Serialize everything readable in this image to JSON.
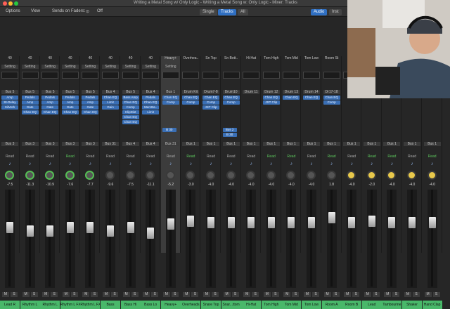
{
  "window": {
    "title": "Writing a Metal Song w/ Only Logic - Writing a Metal Song w: Only Logic - Mixer: Tracks"
  },
  "toolbar": {
    "options": "Options",
    "view": "View",
    "sends_on_faders": "Sends on Faders:",
    "sends_value": "Off",
    "single": "Single",
    "tracks": "Tracks",
    "all": "All",
    "audio": "Audio",
    "inst": "Inst"
  },
  "strips": [
    {
      "name": "Lead R",
      "color": "#49b86a",
      "gain": "40",
      "setting": "Setting",
      "input": "Bus 5",
      "plugins": [
        "Amp",
        "St-Delay",
        "SilVerb"
      ],
      "bus": "Bus 3",
      "read": "Read",
      "read_green": false,
      "vol": "-7.5",
      "pan": "-64",
      "fader": 0.62
    },
    {
      "name": "Rhythm L",
      "color": "#49b86a",
      "gain": "40",
      "setting": "Setting",
      "input": "Bus 5",
      "plugins": [
        "Pedals",
        "Amp",
        "Gate",
        "Chan EQ"
      ],
      "bus": "Bus 3",
      "read": "Read",
      "read_green": false,
      "vol": "-11.3",
      "pan": "-64",
      "fader": 0.58
    },
    {
      "name": "Rhythm L",
      "color": "#49b86a",
      "gain": "40",
      "setting": "Setting",
      "input": "Bus 5",
      "plugins": [
        "Pedals",
        "Amp",
        "Gate",
        "Chan EQ"
      ],
      "bus": "Bus 3",
      "read": "Read",
      "read_green": false,
      "vol": "-10.9",
      "pan": "+63",
      "fader": 0.58
    },
    {
      "name": "Rhythm L FX",
      "color": "#49b86a",
      "gain": "40",
      "setting": "Setting",
      "input": "Bus 5",
      "plugins": [
        "Pedals",
        "Amp",
        "Gate",
        "Chan EQ"
      ],
      "bus": "Bus 3",
      "read": "Read",
      "read_green": true,
      "vol": "-7.6",
      "pan": "-64",
      "fader": 0.62
    },
    {
      "name": "Rhythm L FX",
      "color": "#49b86a",
      "gain": "40",
      "setting": "Setting",
      "input": "Bus 5",
      "plugins": [
        "Pedals",
        "Amp",
        "Gate",
        "Chan EQ"
      ],
      "bus": "Bus 3",
      "read": "Read",
      "read_green": false,
      "vol": "-7.7",
      "pan": "+63",
      "fader": 0.62
    },
    {
      "name": "Bass",
      "color": "#49b86a",
      "gain": "40",
      "setting": "Setting",
      "input": "Bus 4",
      "plugins": [
        "Chan EQ",
        "Limit",
        "Gain"
      ],
      "bus": "Bus 31",
      "read": "Read",
      "read_green": false,
      "vol": "-9.6",
      "pan": "",
      "fader": 0.58
    },
    {
      "name": "Bass Hi",
      "color": "#49b86a",
      "gain": "40",
      "setting": "Setting",
      "input": "Bus 5",
      "plugins": [
        "Bass Amp",
        "Chan EQ",
        "Comp",
        "ClipDist",
        "Chan EQ",
        "Chan EQ"
      ],
      "bus": "Bus 4",
      "read": "Read",
      "read_green": false,
      "vol": "-7.5",
      "pan": "",
      "fader": 0.62
    },
    {
      "name": "Bass Lo",
      "color": "#49b86a",
      "gain": "40",
      "setting": "Setting",
      "input": "Bus 4",
      "plugins": [
        "Pedals",
        "Chan EQ",
        "MercBa..",
        "Limit"
      ],
      "bus": "Bus 4",
      "read": "Read",
      "read_green": false,
      "vol": "-11.1",
      "pan": "",
      "fader": 0.56
    },
    {
      "name": "Heavy+",
      "color": "#49b86a",
      "gain": "Heavy+",
      "setting": "Setting",
      "input": "Bus 1",
      "plugins": [
        "Chan EQ",
        "Comp"
      ],
      "bus": "Bus 31",
      "read": "Read",
      "read_green": false,
      "vol": "-5.2",
      "pan": "",
      "fader": 0.66,
      "selected": true
    },
    {
      "name": "Overheads",
      "color": "#49b86a",
      "gain": "Overhea..",
      "setting": "",
      "input": "Drum Kit",
      "plugins": [
        "Chan EQ",
        "Comp"
      ],
      "bus": "Bus 1",
      "read": "Read",
      "read_green": true,
      "vol": "-3.0",
      "pan": "",
      "fader": 0.7
    },
    {
      "name": "Snare Top",
      "color": "#49b86a",
      "gain": "Sn Top",
      "setting": "",
      "input": "Drum7-8",
      "plugins": [
        "Chan EQ",
        "Comp",
        "JST Clip"
      ],
      "bus": "Bus 1",
      "read": "Read",
      "read_green": false,
      "vol": "-4.0",
      "pan": "",
      "fader": 0.68
    },
    {
      "name": "Snar...ttom",
      "color": "#49b86a",
      "gain": "Sn Bott..",
      "setting": "",
      "input": "Drum10",
      "plugins": [
        "Chan EQ",
        "Comp"
      ],
      "bus": "Bus 1",
      "read": "Read",
      "read_green": false,
      "vol": "-4.0",
      "pan": "",
      "fader": 0.68
    },
    {
      "name": "Hi-Hat",
      "color": "#49b86a",
      "gain": "Hi Hat",
      "setting": "",
      "input": "Drum 11",
      "plugins": [],
      "bus": "Bus 1",
      "read": "Read",
      "read_green": false,
      "vol": "-4.0",
      "pan": "",
      "fader": 0.68
    },
    {
      "name": "Tom High",
      "color": "#49b86a",
      "gain": "Tom High",
      "setting": "",
      "input": "Drum 12",
      "plugins": [
        "Chan EQ",
        "JST Clip"
      ],
      "bus": "Bus 1",
      "read": "Read",
      "read_green": true,
      "vol": "-4.0",
      "pan": "",
      "fader": 0.68
    },
    {
      "name": "Tom Mid",
      "color": "#49b86a",
      "gain": "Tom Mid",
      "setting": "",
      "input": "Drum 13",
      "plugins": [
        "Chan EQ"
      ],
      "bus": "Bus 1",
      "read": "Read",
      "read_green": true,
      "vol": "-4.0",
      "pan": "",
      "fader": 0.68
    },
    {
      "name": "Tom Low",
      "color": "#49b86a",
      "gain": "Tom Low",
      "setting": "",
      "input": "Drum 14",
      "plugins": [
        "Chan EQ"
      ],
      "bus": "Bus 1",
      "read": "Read",
      "read_green": false,
      "vol": "-4.0",
      "pan": "",
      "fader": 0.68
    },
    {
      "name": "Room A",
      "color": "#49b86a",
      "gain": "Room St",
      "setting": "",
      "input": "Dr17-18",
      "plugins": [
        "Chan EQ",
        "Comp"
      ],
      "bus": "Bus 1",
      "read": "Read",
      "read_green": true,
      "vol": "1.8",
      "pan": "",
      "fader": 0.74
    },
    {
      "name": "Room B",
      "color": "#49b86a",
      "gain": "",
      "setting": "",
      "input": "",
      "plugins": [],
      "bus": "Bus 1",
      "read": "Read",
      "read_green": false,
      "vol": "-4.0",
      "pan": "",
      "fader": 0.68
    },
    {
      "name": "Lead",
      "color": "#49b86a",
      "gain": "",
      "setting": "",
      "input": "",
      "plugins": [],
      "bus": "Bus 1",
      "read": "Read",
      "read_green": true,
      "vol": "-2.0",
      "pan": "",
      "fader": 0.7
    },
    {
      "name": "Tambourine",
      "color": "#49b86a",
      "gain": "",
      "setting": "",
      "input": "",
      "plugins": [],
      "bus": "Bus 1",
      "read": "Read",
      "read_green": true,
      "vol": "-4.0",
      "pan": "",
      "fader": 0.68
    },
    {
      "name": "Shaker",
      "color": "#49b86a",
      "gain": "",
      "setting": "",
      "input": "",
      "plugins": [],
      "bus": "Bus 1",
      "read": "Read",
      "read_green": false,
      "vol": "-4.0",
      "pan": "",
      "fader": 0.68
    },
    {
      "name": "Hand Clap",
      "color": "#49b86a",
      "gain": "",
      "setting": "",
      "input": "",
      "plugins": [],
      "bus": "Bus 1",
      "read": "Read",
      "read_green": true,
      "vol": "-4.0",
      "pan": "",
      "fader": 0.68
    }
  ],
  "sends": {
    "heavy_send": "B 30",
    "drum_sends": [
      "Bus 2",
      "B 30"
    ]
  },
  "icons": {
    "traffic_close": "#ff5f57",
    "traffic_min": "#febc2e",
    "traffic_max": "#28c840"
  }
}
